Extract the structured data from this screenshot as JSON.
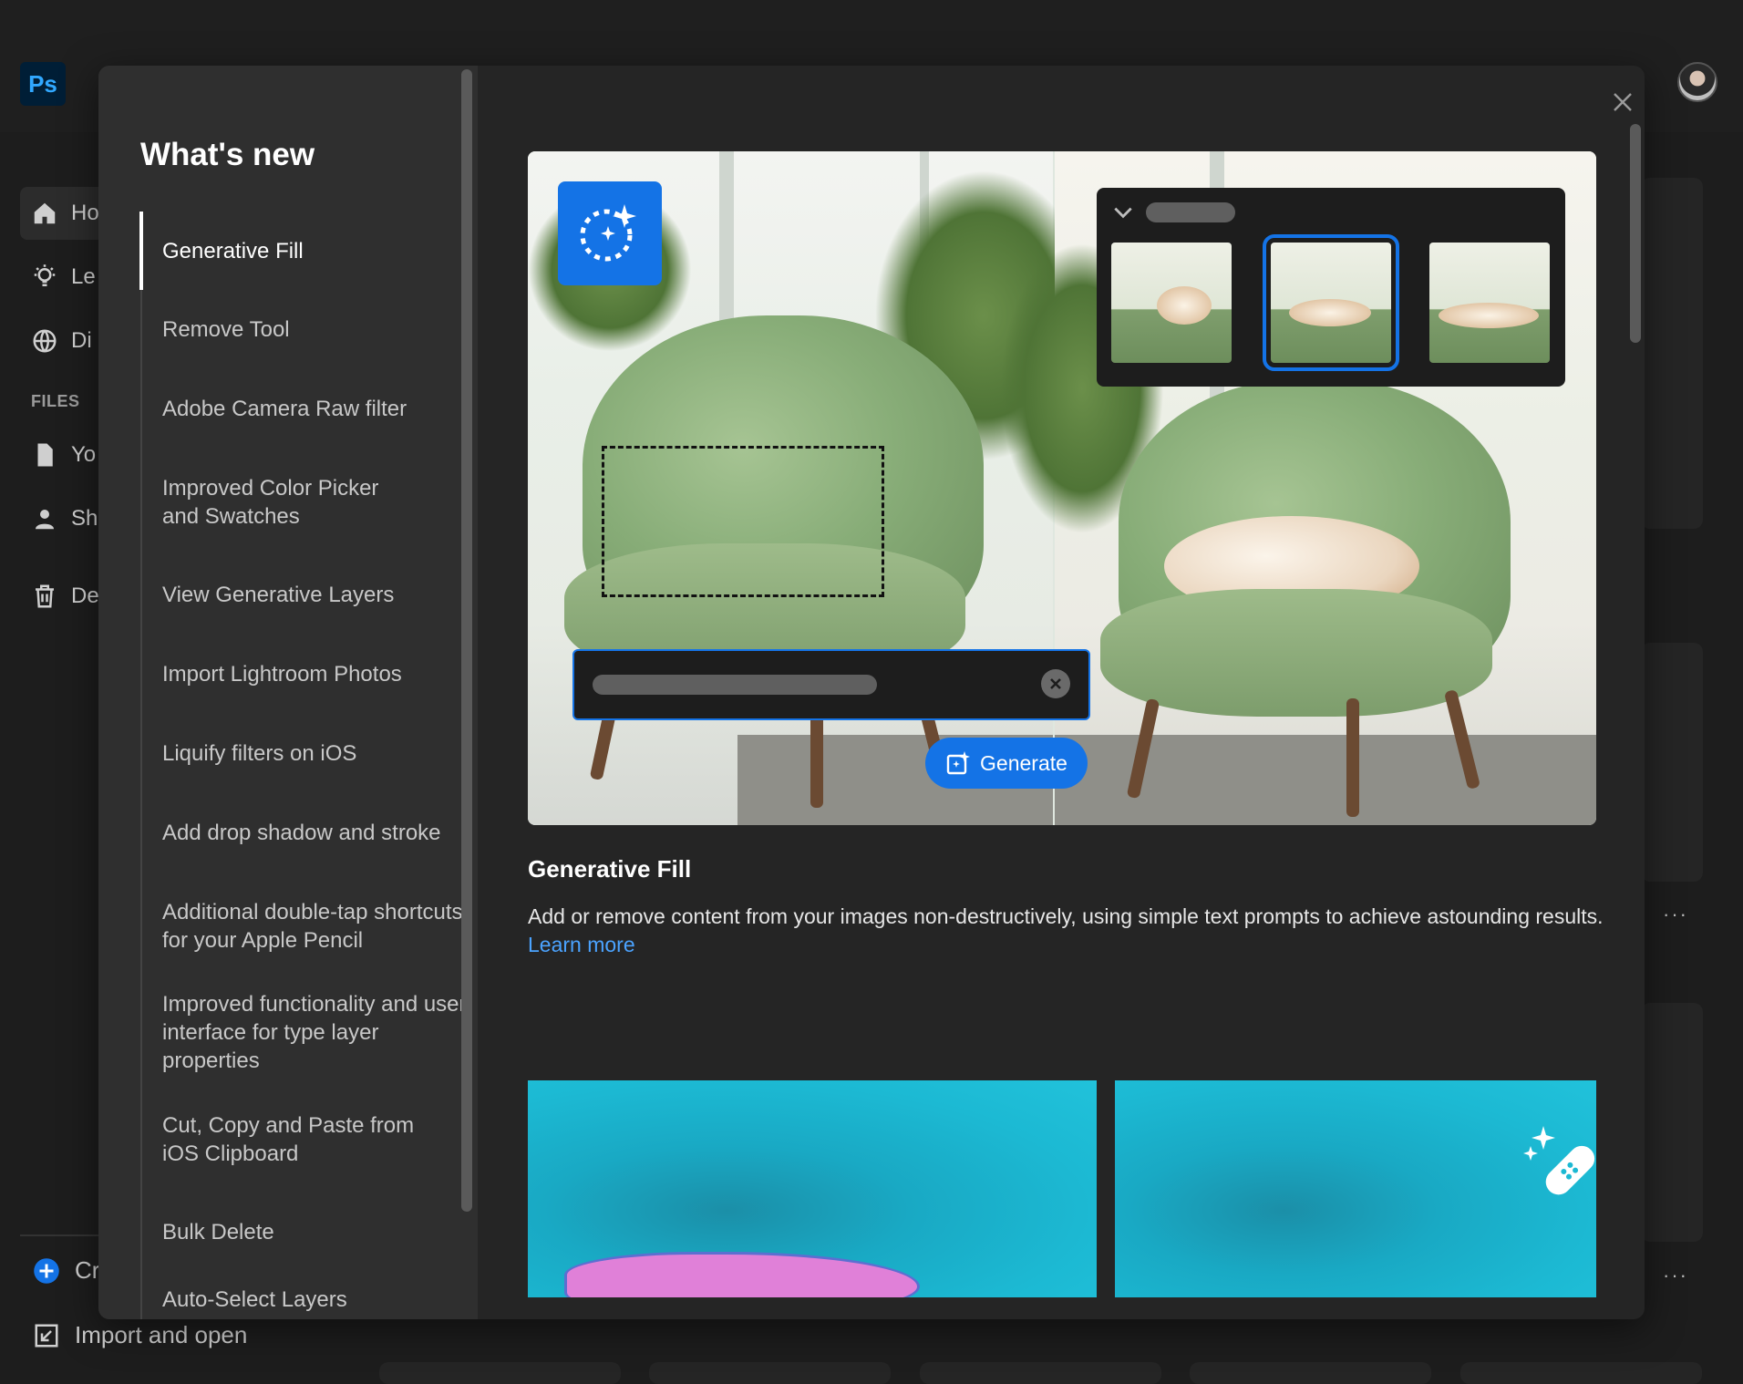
{
  "app": {
    "logo_text": "Ps",
    "sidebar": [
      {
        "icon": "home-icon",
        "label": "Ho"
      },
      {
        "icon": "lightbulb-icon",
        "label": "Le"
      },
      {
        "icon": "globe-icon",
        "label": "Di"
      }
    ],
    "files_label": "FILES",
    "files_items": [
      {
        "icon": "file-icon",
        "label": "Yo"
      },
      {
        "icon": "shared-user-icon",
        "label": "Sh"
      },
      {
        "icon": "trash-icon",
        "label": "De"
      }
    ],
    "create_label": "Cr",
    "import_label": "Import and open",
    "more_label": "···"
  },
  "modal": {
    "title": "What's new",
    "nav_items": [
      "Generative Fill",
      "Remove Tool",
      "Adobe Camera Raw filter",
      "Improved Color Picker\nand Swatches",
      "View Generative Layers",
      "Import Lightroom Photos",
      "Liquify filters on iOS",
      "Add drop shadow and stroke",
      "Additional double-tap shortcuts\nfor your Apple Pencil",
      "Improved functionality and user\ninterface for type layer properties",
      "Cut, Copy and Paste from\niOS Clipboard",
      "Bulk Delete",
      "Auto-Select Layers"
    ],
    "active_index": 0,
    "hero": {
      "generate_label": "Generate"
    },
    "feature": {
      "title": "Generative Fill",
      "description": "Add or remove content from your images non-destructively, using simple text prompts to achieve astounding results.",
      "learn_more": "Learn more"
    }
  },
  "colors": {
    "accent": "#1473e6",
    "link": "#4ba3ff",
    "modal_bg": "#252525",
    "nav_bg": "#2f2f2f"
  }
}
